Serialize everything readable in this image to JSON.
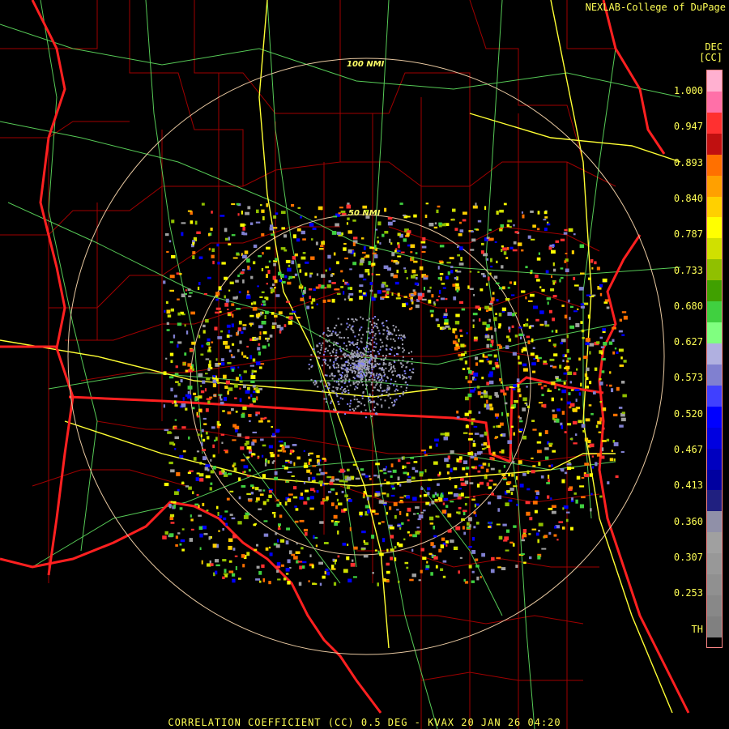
{
  "credit": "NEXLAB-College of DuPage",
  "footer": "CORRELATION COEFFICIENT (CC) 0.5 DEG - KVAX 20 JAN 26 04:20",
  "legend": {
    "unit_top": "DEC",
    "unit": "[CC]",
    "ticks": [
      "1.000",
      "0.947",
      "0.893",
      "0.840",
      "0.787",
      "0.733",
      "0.680",
      "0.627",
      "0.573",
      "0.520",
      "0.467",
      "0.413",
      "0.360",
      "0.307",
      "0.253",
      "TH"
    ]
  },
  "range_rings": {
    "inner_label": "50 NMI",
    "outer_label": "100 NMI"
  },
  "colors": {
    "background": "#000000",
    "state_border": "#ff2020",
    "county_border": "#a00000",
    "highway": "#ffff33",
    "road": "#66ee66",
    "range_ring": "#e8c8a0",
    "label": "#ffff55"
  }
}
